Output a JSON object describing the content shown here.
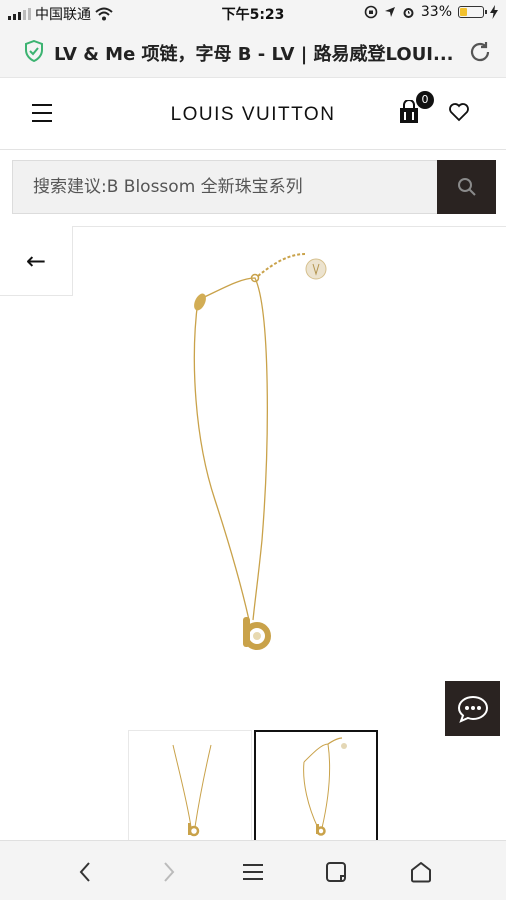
{
  "status_bar": {
    "carrier": "中国联通",
    "time": "下午5:23",
    "battery": "33%",
    "battery_level": 0.33
  },
  "address_bar": {
    "title": "LV & Me 项链，字母 B - LV | 路易威登LOUI..."
  },
  "header": {
    "logo": "LOUIS VUITTON",
    "cart_count": "0"
  },
  "search": {
    "placeholder": "搜索建议:B Blossom 全新珠宝系列"
  },
  "nav": {
    "back_arrow": "←"
  },
  "icons": {
    "shield": "shield-icon",
    "reload": "reload-icon",
    "menu": "menu-icon",
    "bag": "shopping-bag-icon",
    "heart": "heart-icon",
    "search": "search-icon",
    "chat": "chat-icon",
    "browser_back": "chevron-left-icon",
    "browser_forward": "chevron-right-icon",
    "browser_menu": "menu-icon",
    "browser_tabs": "tabs-icon",
    "browser_home": "home-icon"
  },
  "colors": {
    "accent_dark": "#2a2321",
    "shield_green": "#3cb371",
    "gold": "#c9a24a",
    "battery_yellow": "#f2c12e"
  }
}
